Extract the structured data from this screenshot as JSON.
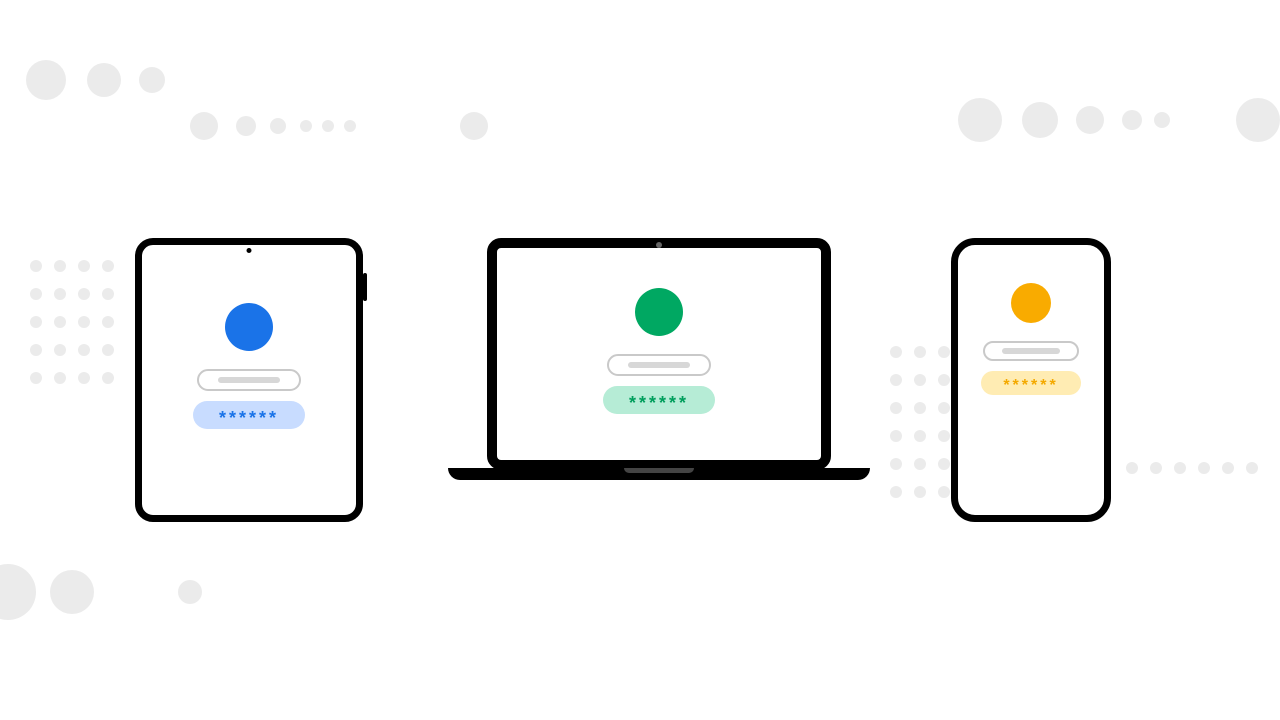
{
  "colors": {
    "blue": "#1a73e8",
    "green": "#00a862",
    "yellow": "#f9ab00",
    "grey": "#ebebeb"
  },
  "devices": {
    "tablet": {
      "password_mask": "******"
    },
    "laptop": {
      "password_mask": "******"
    },
    "phone": {
      "password_mask": "******"
    }
  }
}
